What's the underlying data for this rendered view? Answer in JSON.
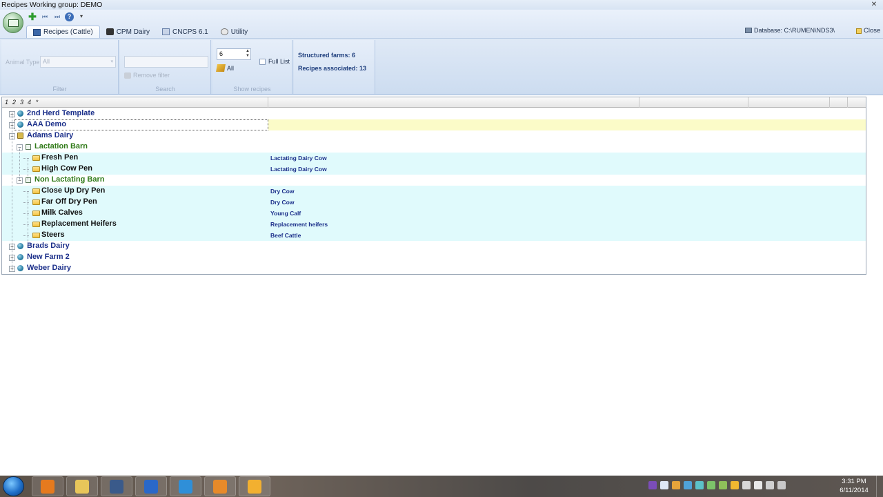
{
  "titlebar": {
    "title": "Recipes   Working group:  DEMO",
    "close_glyph": "✕"
  },
  "qat": {
    "icons": [
      "add-icon",
      "first-record-icon",
      "last-record-icon",
      "help-icon",
      "customize-dropdown-icon"
    ],
    "plus_glyph": "✚",
    "first_glyph": "⏮",
    "last_glyph": "⏭",
    "help_glyph": "?",
    "dropdown_glyph": "▾"
  },
  "tabs": [
    {
      "label": "Recipes (Cattle)",
      "icon": "cattle-icon",
      "active": true
    },
    {
      "label": "CPM Dairy",
      "icon": "cpm-icon",
      "active": false
    },
    {
      "label": "CNCPS 6.1",
      "icon": "cncps-icon",
      "active": false
    },
    {
      "label": "Utility",
      "icon": "utility-icon",
      "active": false
    }
  ],
  "database": {
    "label": "Database: C:\\RUMEN\\NDS3\\"
  },
  "close": {
    "label": "Close"
  },
  "ribbon": {
    "filter": {
      "animal_type_label": "Animal Type",
      "animal_type_value": "All",
      "dropdown_glyph": "▾",
      "group_label": "Filter"
    },
    "search": {
      "input_value": "",
      "remove_filter_label": "Remove filter",
      "group_label": "Search"
    },
    "show": {
      "spin_value": "6",
      "spin_arrows": "▲\n▼",
      "all_label": "All",
      "full_list_label": "Full List",
      "group_label": "Show recipes"
    },
    "info": {
      "structured_farms": "Structured farms:  6",
      "recipes_associated": "Recipes associated:  13"
    }
  },
  "grid": {
    "levels": [
      "1",
      "2",
      "3",
      "4",
      "*"
    ],
    "rows": [
      {
        "level": 0,
        "label": "2nd Herd Template",
        "type": "",
        "kind": "farm",
        "expander": "+"
      },
      {
        "level": 0,
        "label": "AAA Demo",
        "type": "",
        "kind": "farm",
        "expander": "+",
        "selected": true
      },
      {
        "level": 0,
        "label": "Adams Dairy",
        "type": "",
        "kind": "farm-open",
        "expander": "−"
      },
      {
        "level": 1,
        "label": "Lactation Barn",
        "type": "",
        "kind": "barn",
        "expander": "−"
      },
      {
        "level": 2,
        "label": "Fresh Pen",
        "type": "Lactating Dairy Cow",
        "kind": "pen"
      },
      {
        "level": 2,
        "label": "High Cow Pen",
        "type": "Lactating Dairy Cow",
        "kind": "pen"
      },
      {
        "level": 1,
        "label": "Non Lactating Barn",
        "type": "",
        "kind": "barn",
        "expander": "−"
      },
      {
        "level": 2,
        "label": "Close Up Dry Pen",
        "type": "Dry Cow",
        "kind": "pen"
      },
      {
        "level": 2,
        "label": "Far Off Dry Pen",
        "type": "Dry Cow",
        "kind": "pen"
      },
      {
        "level": 2,
        "label": "Milk Calves",
        "type": "Young Calf",
        "kind": "pen"
      },
      {
        "level": 2,
        "label": "Replacement Heifers",
        "type": "Replacement heifers",
        "kind": "pen"
      },
      {
        "level": 2,
        "label": "Steers",
        "type": "Beef Cattle",
        "kind": "pen"
      },
      {
        "level": 0,
        "label": "Brads Dairy",
        "type": "",
        "kind": "farm",
        "expander": "+"
      },
      {
        "level": 0,
        "label": "New Farm 2",
        "type": "",
        "kind": "farm",
        "expander": "+"
      },
      {
        "level": 0,
        "label": "Weber Dairy",
        "type": "",
        "kind": "farm",
        "expander": "+"
      }
    ]
  },
  "taskbar": {
    "apps": [
      "media-player-icon",
      "file-explorer-icon",
      "app-icon",
      "nds-icon",
      "internet-explorer-icon",
      "outlook-icon",
      "app-flower-icon"
    ],
    "tray_icons": [
      "onenote-icon",
      "bluetooth-icon",
      "app-tray-icon",
      "network-icon",
      "sync-icon",
      "monitor-icon",
      "usb-icon",
      "security-icon",
      "speaker-icon",
      "signal-icon",
      "volume-icon",
      "power-icon"
    ],
    "time": "3:31 PM",
    "date": "6/11/2014"
  },
  "colors": {
    "farm_text": "#1b2f8a",
    "barn_text": "#2f7a17",
    "pen_row_bg": "#e0fafc",
    "selected_row_bg": "#fbfbc8"
  }
}
